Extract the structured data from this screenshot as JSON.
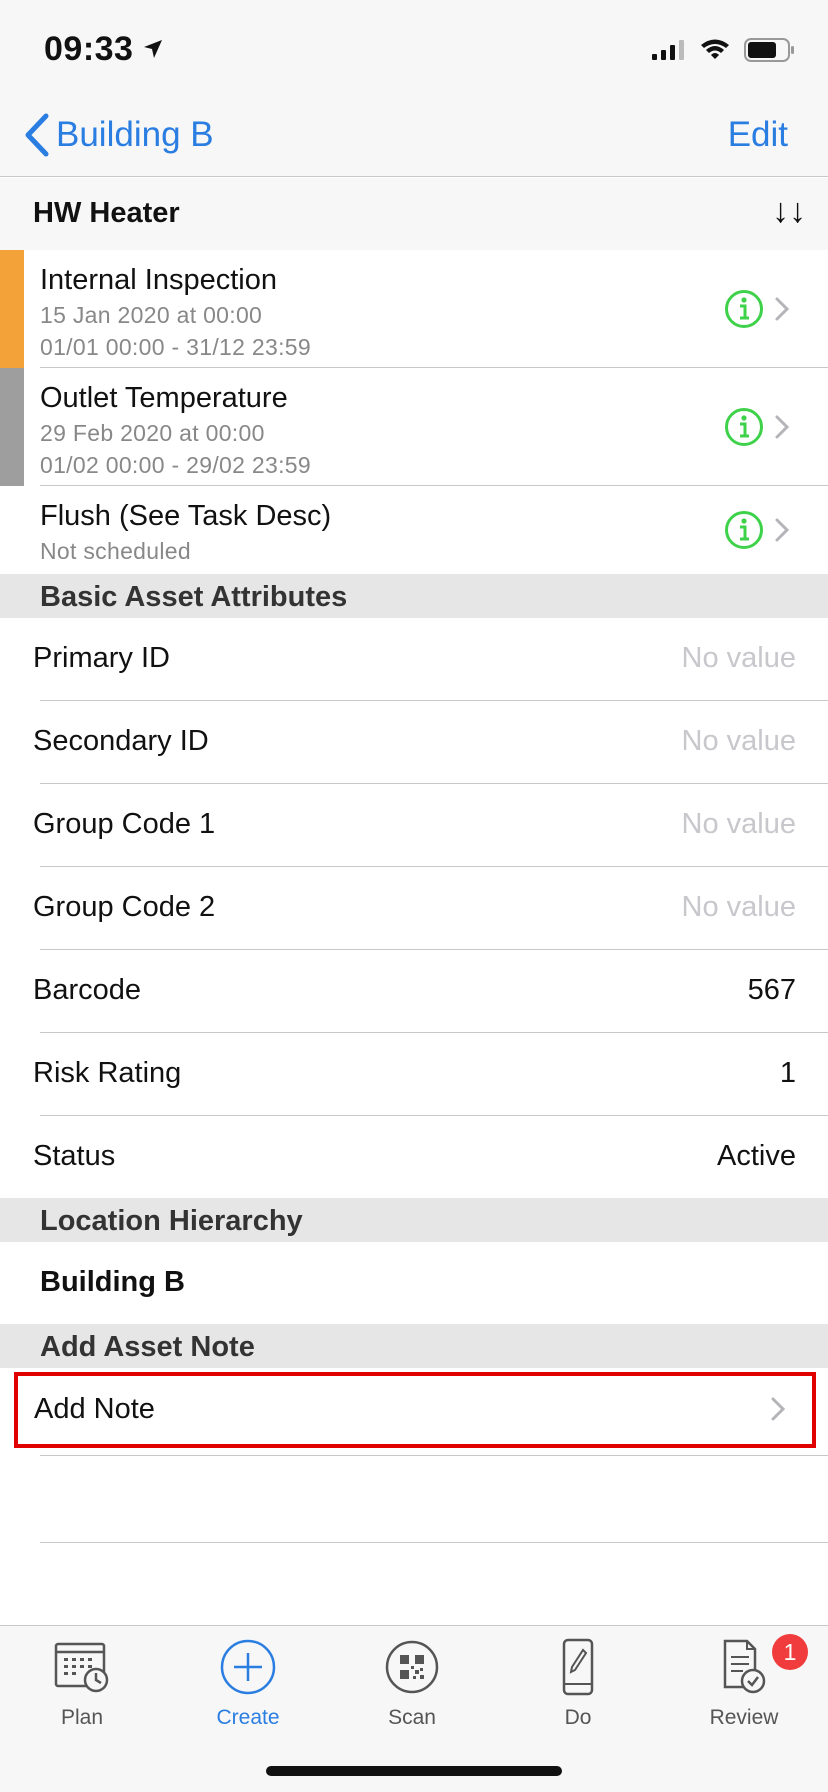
{
  "status_bar": {
    "time": "09:33"
  },
  "nav": {
    "back_label": "Building B",
    "edit_label": "Edit"
  },
  "asset": {
    "title": "HW Heater"
  },
  "tasks": [
    {
      "title": "Internal Inspection",
      "date": "15 Jan 2020 at 00:00",
      "window": "01/01 00:00 - 31/12 23:59",
      "stripe_color": "#f3a23a"
    },
    {
      "title": "Outlet Temperature",
      "date": "29 Feb 2020 at 00:00",
      "window": "01/02 00:00 - 29/02 23:59",
      "stripe_color": "#9e9e9e"
    },
    {
      "title": "Flush (See Task Desc)",
      "date": "Not scheduled",
      "window": "",
      "stripe_color": ""
    }
  ],
  "basic_attributes": {
    "header": "Basic Asset Attributes",
    "rows": [
      {
        "label": "Primary ID",
        "value": "No value",
        "empty": true
      },
      {
        "label": "Secondary ID",
        "value": "No value",
        "empty": true
      },
      {
        "label": "Group Code 1",
        "value": "No value",
        "empty": true
      },
      {
        "label": "Group Code 2",
        "value": "No value",
        "empty": true
      },
      {
        "label": "Barcode",
        "value": "567",
        "empty": false
      },
      {
        "label": "Risk Rating",
        "value": "1",
        "empty": false
      },
      {
        "label": "Status",
        "value": "Active",
        "empty": false
      }
    ]
  },
  "location": {
    "header": "Location Hierarchy",
    "name": "Building B"
  },
  "asset_note": {
    "header": "Add Asset Note",
    "add_label": "Add Note"
  },
  "tab_bar": {
    "tabs": [
      {
        "label": "Plan",
        "icon": "calendar-clock-icon"
      },
      {
        "label": "Create",
        "icon": "plus-circle-icon"
      },
      {
        "label": "Scan",
        "icon": "qr-code-icon"
      },
      {
        "label": "Do",
        "icon": "phone-pencil-icon"
      },
      {
        "label": "Review",
        "icon": "document-check-icon"
      }
    ],
    "review_badge": "1"
  },
  "colors": {
    "accent": "#2a7de1",
    "info_green": "#3ed14a",
    "badge_red": "#f03c3c",
    "highlight_red": "#e00000"
  }
}
